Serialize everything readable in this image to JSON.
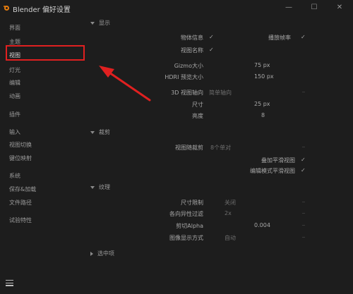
{
  "window": {
    "title": "Blender 偏好设置",
    "minimize_glyph": "—",
    "maximize_glyph": "☐",
    "close_glyph": "✕"
  },
  "sidebar": {
    "items": [
      {
        "label": "界面"
      },
      {
        "label": "主题"
      },
      {
        "label": "视图"
      },
      {
        "label": "灯光"
      },
      {
        "label": "编辑"
      },
      {
        "label": "动画"
      },
      {
        "label": "插件"
      },
      {
        "label": "输入"
      },
      {
        "label": "视图切换"
      },
      {
        "label": "键位映射"
      },
      {
        "label": "系统"
      },
      {
        "label": "保存&加载"
      },
      {
        "label": "文件路径"
      },
      {
        "label": "试验特性"
      }
    ],
    "active_index": 2
  },
  "sections": {
    "display": {
      "title": "显示",
      "object_info_label": "物体信息",
      "object_info_check": "✓",
      "playback_fps_label": "播放帧率",
      "playback_fps_check": "✓",
      "view_name_label": "视图名称",
      "view_name_check": "✓",
      "gizmo_size_label": "Gizmo大小",
      "gizmo_size_value": "75 px",
      "hdri_preview_label": "HDRI 预览大小",
      "hdri_preview_value": "150 px",
      "view_axis_label": "3D 视图轴向",
      "view_axis_value": "简单轴向",
      "size_label": "尺寸",
      "size_value": "25 px",
      "brightness_label": "亮度",
      "brightness_value": "8"
    },
    "clipping": {
      "title": "裁剪",
      "clip_alignment_label": "视图随裁剪",
      "clip_alignment_value": "8个单对",
      "overlay_label": "叠加平滑视图",
      "overlay_check": "✓",
      "edit_mode_label": "编辑模式平滑视图",
      "edit_mode_check": "✓"
    },
    "textures": {
      "title": "纹理",
      "size_limit_label": "尺寸限制",
      "size_limit_value": "关闭",
      "anisotropic_label": "各向异性过滤",
      "anisotropic_value": "2x",
      "clip_alpha_label": "剪切Alpha",
      "clip_alpha_value": "0.004",
      "image_display_label": "图像显示方式",
      "image_display_value": "自动"
    },
    "selection": {
      "title": "选中项"
    }
  }
}
